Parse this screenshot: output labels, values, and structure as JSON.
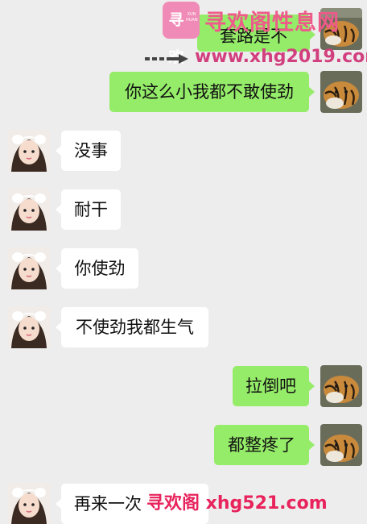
{
  "chat": {
    "messages": [
      {
        "side": "out",
        "text": "套路是不"
      },
      {
        "side": "out",
        "text": "你这么小我都不敢使劲"
      },
      {
        "side": "in",
        "text": "没事"
      },
      {
        "side": "in",
        "text": "耐干"
      },
      {
        "side": "in",
        "text": "你使劲"
      },
      {
        "side": "in",
        "text": "不使劲我都生气"
      },
      {
        "side": "out",
        "text": "拉倒吧"
      },
      {
        "side": "out",
        "text": "都整疼了"
      },
      {
        "side": "in",
        "text": "再来一次"
      }
    ]
  },
  "watermark": {
    "logo_glyph": "寻欢",
    "logo_small": "XUN HUAN",
    "title": "寻欢阁性息网",
    "url_top": "www.xhg2019.com",
    "bottom": "寻欢阁 xhg521.com"
  },
  "colors": {
    "background": "#ededed",
    "incoming_bubble": "#ffffff",
    "outgoing_bubble": "#95ec69",
    "watermark_pink": "#ee5a8a"
  },
  "icons": {
    "incoming_avatar": "girl-avatar-icon",
    "outgoing_avatar": "tiger-avatar-icon",
    "arrow": "arrow-right-icon"
  }
}
